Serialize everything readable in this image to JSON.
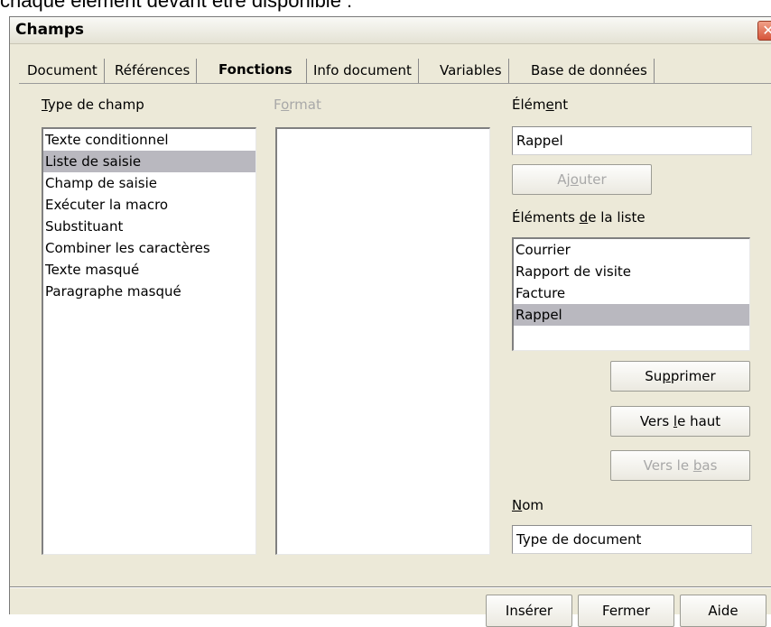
{
  "caption": "chaque élément devant être disponible :",
  "window": {
    "title": "Champs",
    "close_glyph": "✕"
  },
  "tabs": [
    {
      "label": "Document",
      "active": false
    },
    {
      "label": "Références",
      "active": false
    },
    {
      "label": "Fonctions",
      "active": true
    },
    {
      "label": "Info document",
      "active": false
    },
    {
      "label": "Variables",
      "active": false
    },
    {
      "label": "Base de données",
      "active": false
    }
  ],
  "type_de_champ": {
    "label_pre": "",
    "label_u": "T",
    "label_post": "ype de champ",
    "items": [
      "Texte conditionnel",
      "Liste de saisie",
      "Champ de saisie",
      "Exécuter la macro",
      "Substituant",
      "Combiner les caractères",
      "Texte masqué",
      "Paragraphe masqué"
    ],
    "selected_index": 1
  },
  "format": {
    "label_pre": "F",
    "label_u": "o",
    "label_post": "rmat"
  },
  "element": {
    "label_pre": "Élém",
    "label_u": "e",
    "label_post": "nt",
    "value": "Rappel",
    "add_pre": "Aj",
    "add_u": "o",
    "add_post": "uter"
  },
  "elements_liste": {
    "label_pre": "Éléments ",
    "label_u": "d",
    "label_post": "e la liste",
    "items": [
      "Courrier",
      "Rapport de visite",
      "Facture",
      "Rappel"
    ],
    "selected_index": 3
  },
  "buttons": {
    "delete_pre": "Su",
    "delete_u": "p",
    "delete_post": "primer",
    "up_pre": "Vers ",
    "up_u": "l",
    "up_post": "e haut",
    "down_pre": "Vers le ",
    "down_u": "b",
    "down_post": "as"
  },
  "nom": {
    "label_pre": "",
    "label_u": "N",
    "label_post": "om",
    "value": "Type de document"
  },
  "footer": {
    "insert": "Insérer",
    "close": "Fermer",
    "help": "Aide"
  }
}
